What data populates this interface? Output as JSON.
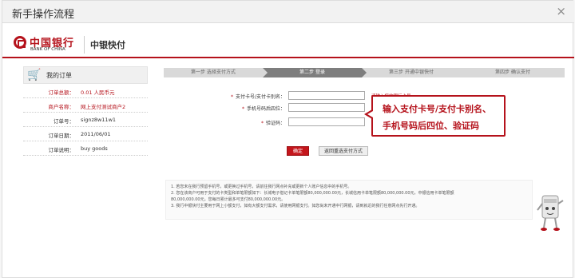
{
  "window": {
    "title": "新手操作流程",
    "close_glyph": "×"
  },
  "brand": {
    "logo_cn": "中国银行",
    "logo_en": "BANK OF CHINA",
    "product": "中银快付",
    "accent_color": "#b5121b"
  },
  "order": {
    "header": "我的订单",
    "icon": "cart-icon",
    "rows": [
      {
        "label": "订单总额：",
        "value": "0.01 人民币元",
        "highlight": true
      },
      {
        "label": "商户名称：",
        "value": "网上支付测试商户2",
        "highlight": true
      },
      {
        "label": "订单号：",
        "value": "signz8w11w1",
        "highlight": false
      },
      {
        "label": "订单日期：",
        "value": "2011/06/01",
        "highlight": false
      },
      {
        "label": "订单说明：",
        "value": "buy goods",
        "highlight": false
      }
    ]
  },
  "steps": [
    {
      "label": "第一步  选择支付方式",
      "active": false
    },
    {
      "label": "第二步  登录",
      "active": true
    },
    {
      "label": "第三步  开通中银快付",
      "active": false
    },
    {
      "label": "第四步  确认支付",
      "active": false
    }
  ],
  "form": {
    "fields": [
      {
        "label": "支付卡号/支付卡别名：",
        "value": ""
      },
      {
        "label": "手机号码后四位：",
        "value": ""
      },
      {
        "label": "验证码：",
        "value": ""
      }
    ],
    "hint": "请输入您的银行卡号",
    "confirm_label": "确定",
    "back_label": "返回重选支付方式"
  },
  "callout": {
    "line1": "输入支付卡号/支付卡别名、",
    "line2": "手机号码后四位、验证码"
  },
  "notes": [
    "1. 若您未在我行预留手机号，或更换过手机号，请前往我行网点补充或更新个人账户信息中的手机号。",
    "2. 您在该商户可用于支付的卡类型和单笔限额如下：长城电子借记卡单笔限额80,000,000.00元，长城信用卡单笔限额80,000,000.00元，中银信用卡单笔限额",
    "    80,000,000.00元，您每日累计最多可支付80,000,000.00元。",
    "3. 我行中银快付主要用于网上小额支付，如有大额支付需求，请使用网银支付。如您尚未开通中行网银，请到就近的我行任意网点先行开通。"
  ]
}
